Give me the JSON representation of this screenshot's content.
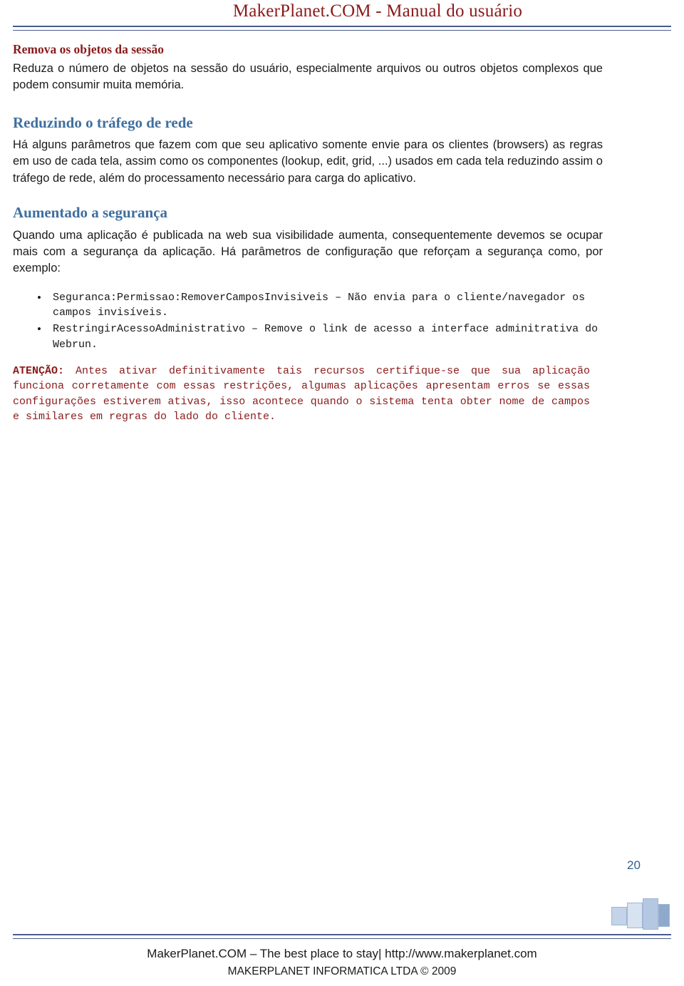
{
  "header": {
    "title": "MakerPlanet.COM - Manual do usuário"
  },
  "content": {
    "subhead_1": "Remova os objetos da sessão",
    "para_1": "Reduza o número de objetos na sessão do usuário, especialmente arquivos ou outros objetos complexos que podem consumir muita memória.",
    "section_1_title": "Reduzindo o tráfego de rede",
    "section_1_para": "Há alguns parâmetros que fazem com que seu aplicativo somente envie para os clientes (browsers) as regras em uso de cada tela, assim como os componentes (lookup, edit, grid, ...) usados em cada tela reduzindo assim o tráfego de rede, além do processamento necessário para carga do aplicativo.",
    "section_2_title": "Aumentado a segurança",
    "section_2_para": "Quando uma aplicação é publicada na web sua visibilidade aumenta, consequentemente devemos se ocupar mais com a segurança da aplicação. Há parâmetros de configuração que reforçam a segurança como, por exemplo:",
    "bullets": [
      "Seguranca:Permissao:RemoverCamposInvisiveis – Não envia para o cliente/navegador os campos invisíveis.",
      "RestringirAcessoAdministrativo – Remove o link de acesso a interface adminitrativa do Webrun."
    ],
    "warning_label": "ATENÇÃO:",
    "warning_text": " Antes ativar definitivamente tais recursos certifique-se que sua aplicação funciona corretamente com essas restrições, algumas aplicações apresentam erros se essas configurações estiverem ativas, isso acontece quando o sistema tenta obter nome de campos e similares em regras do lado do cliente."
  },
  "page_number": "20",
  "footer": {
    "line1": "MakerPlanet.COM – The best place to stay| http://www.makerplanet.com",
    "line2": "MAKERPLANET INFORMATICA LTDA © 2009"
  }
}
